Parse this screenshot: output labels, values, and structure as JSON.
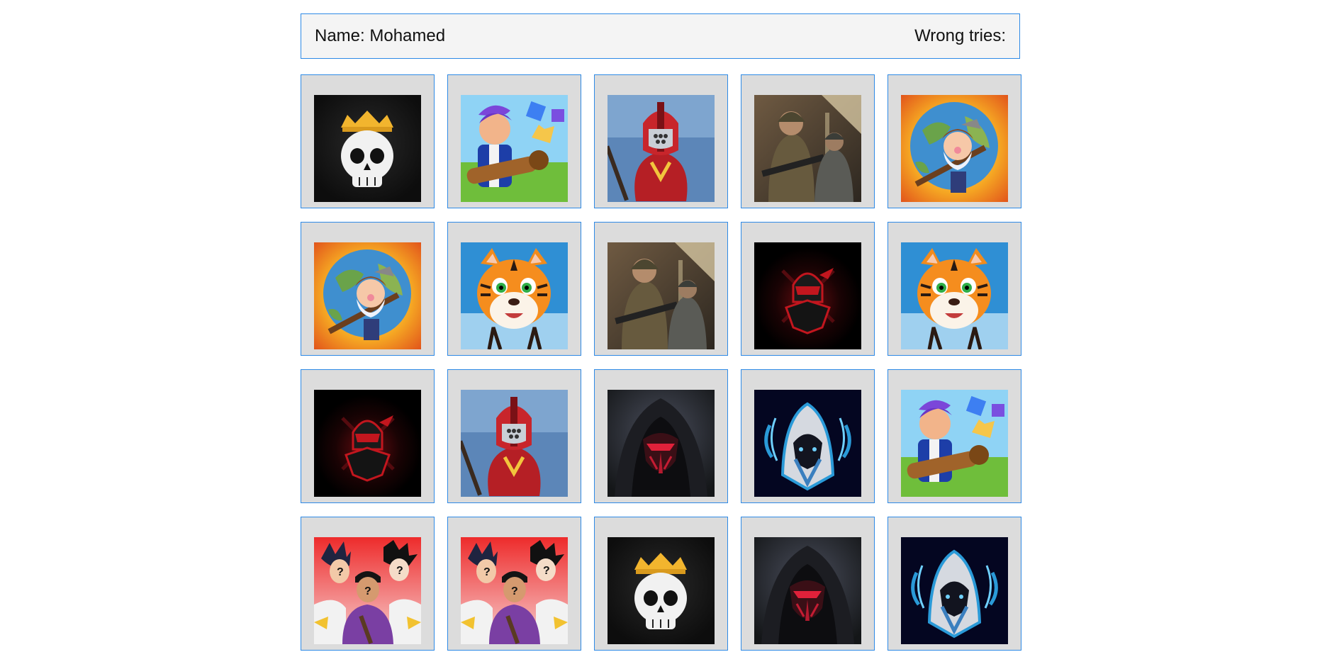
{
  "header": {
    "name_label": "Name:",
    "name_value": "Mohamed",
    "wrong_tries_label": "Wrong tries:",
    "wrong_tries_value": ""
  },
  "cards": [
    {
      "icon": "crowned-skull-icon"
    },
    {
      "icon": "boy-with-bazooka-icon"
    },
    {
      "icon": "red-helmet-warrior-icon"
    },
    {
      "icon": "soldiers-icon"
    },
    {
      "icon": "globe-miner-icon"
    },
    {
      "icon": "globe-miner-icon"
    },
    {
      "icon": "cartoon-tiger-icon"
    },
    {
      "icon": "soldiers-icon"
    },
    {
      "icon": "red-ninja-icon"
    },
    {
      "icon": "cartoon-tiger-icon"
    },
    {
      "icon": "red-ninja-icon"
    },
    {
      "icon": "red-helmet-warrior-icon"
    },
    {
      "icon": "hooded-reaper-icon"
    },
    {
      "icon": "blue-hooded-assassin-icon"
    },
    {
      "icon": "boy-with-bazooka-icon"
    },
    {
      "icon": "mystery-anime-characters-icon"
    },
    {
      "icon": "mystery-anime-characters-icon"
    },
    {
      "icon": "crowned-skull-icon"
    },
    {
      "icon": "hooded-reaper-icon"
    },
    {
      "icon": "blue-hooded-assassin-icon"
    }
  ]
}
